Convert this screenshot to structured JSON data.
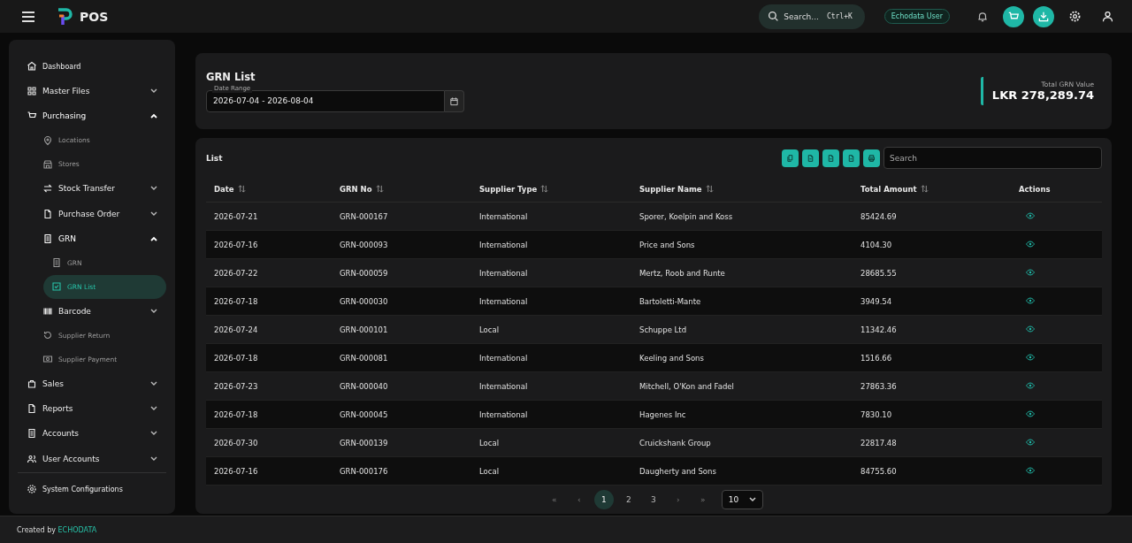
{
  "app": {
    "title": "POS"
  },
  "topbar": {
    "search_placeholder": "Search...",
    "shortcut": "Ctrl+K",
    "user_badge": "Echodata User"
  },
  "sidebar": {
    "items": [
      {
        "label": "Dashboard",
        "kind": "small",
        "selected": false
      },
      {
        "label": "Master Files",
        "kind": "group",
        "expanded": false,
        "selected": false
      },
      {
        "label": "Purchasing",
        "kind": "group",
        "expanded": true,
        "selected": false,
        "children": [
          {
            "label": "Locations",
            "kind": "link",
            "selected": false
          },
          {
            "label": "Stores",
            "kind": "link",
            "selected": false
          },
          {
            "label": "Stock Transfer",
            "kind": "group",
            "expanded": false,
            "selected": false
          },
          {
            "label": "Purchase Order",
            "kind": "group",
            "expanded": false,
            "selected": false
          },
          {
            "label": "GRN",
            "kind": "group",
            "expanded": true,
            "selected": false,
            "children": [
              {
                "label": "GRN",
                "kind": "link",
                "selected": false
              },
              {
                "label": "GRN List",
                "kind": "link",
                "selected": true
              }
            ]
          },
          {
            "label": "Barcode",
            "kind": "group",
            "expanded": false,
            "selected": false
          },
          {
            "label": "Supplier Return",
            "kind": "link",
            "selected": false
          },
          {
            "label": "Supplier Payment",
            "kind": "link",
            "selected": false
          }
        ]
      },
      {
        "label": "Sales",
        "kind": "group",
        "expanded": false,
        "selected": false
      },
      {
        "label": "Reports",
        "kind": "group",
        "expanded": false,
        "selected": false
      },
      {
        "label": "Accounts",
        "kind": "group",
        "expanded": false,
        "selected": false
      },
      {
        "label": "User Accounts",
        "kind": "group",
        "expanded": false,
        "selected": false
      }
    ],
    "footer_item": {
      "label": "System Configurations"
    }
  },
  "header": {
    "title": "GRN List",
    "date_range": {
      "label": "Date Range",
      "value": "2026-07-04 - 2026-08-04"
    },
    "total": {
      "label": "Total GRN Value",
      "value": "LKR 278,289.74"
    }
  },
  "list": {
    "title": "List",
    "search_placeholder": "Search",
    "columns": [
      "Date",
      "GRN No",
      "Supplier Type",
      "Supplier Name",
      "Total Amount",
      "Actions"
    ],
    "rows": [
      [
        "2026-07-21",
        "GRN-000167",
        "International",
        "Sporer, Koelpin and Koss",
        "85424.69"
      ],
      [
        "2026-07-16",
        "GRN-000093",
        "International",
        "Price and Sons",
        "4104.30"
      ],
      [
        "2026-07-22",
        "GRN-000059",
        "International",
        "Mertz, Roob and Runte",
        "28685.55"
      ],
      [
        "2026-07-18",
        "GRN-000030",
        "International",
        "Bartoletti-Mante",
        "3949.54"
      ],
      [
        "2026-07-24",
        "GRN-000101",
        "Local",
        "Schuppe Ltd",
        "11342.46"
      ],
      [
        "2026-07-18",
        "GRN-000081",
        "International",
        "Keeling and Sons",
        "1516.66"
      ],
      [
        "2026-07-23",
        "GRN-000040",
        "International",
        "Mitchell, O'Kon and Fadel",
        "27863.36"
      ],
      [
        "2026-07-18",
        "GRN-000045",
        "International",
        "Hagenes Inc",
        "7830.10"
      ],
      [
        "2026-07-30",
        "GRN-000139",
        "Local",
        "Cruickshank Group",
        "22817.48"
      ],
      [
        "2026-07-16",
        "GRN-000176",
        "Local",
        "Daugherty and Sons",
        "84755.60"
      ]
    ],
    "pagination": {
      "first": "«",
      "prev": "‹",
      "pages": [
        {
          "label": "1",
          "selected": true
        },
        {
          "label": "2",
          "selected": false
        },
        {
          "label": "3",
          "selected": false
        }
      ],
      "next": "›",
      "last": "»",
      "page_size": "10"
    }
  },
  "footer": {
    "prefix": "Created by",
    "brand": "ECHODATA"
  }
}
